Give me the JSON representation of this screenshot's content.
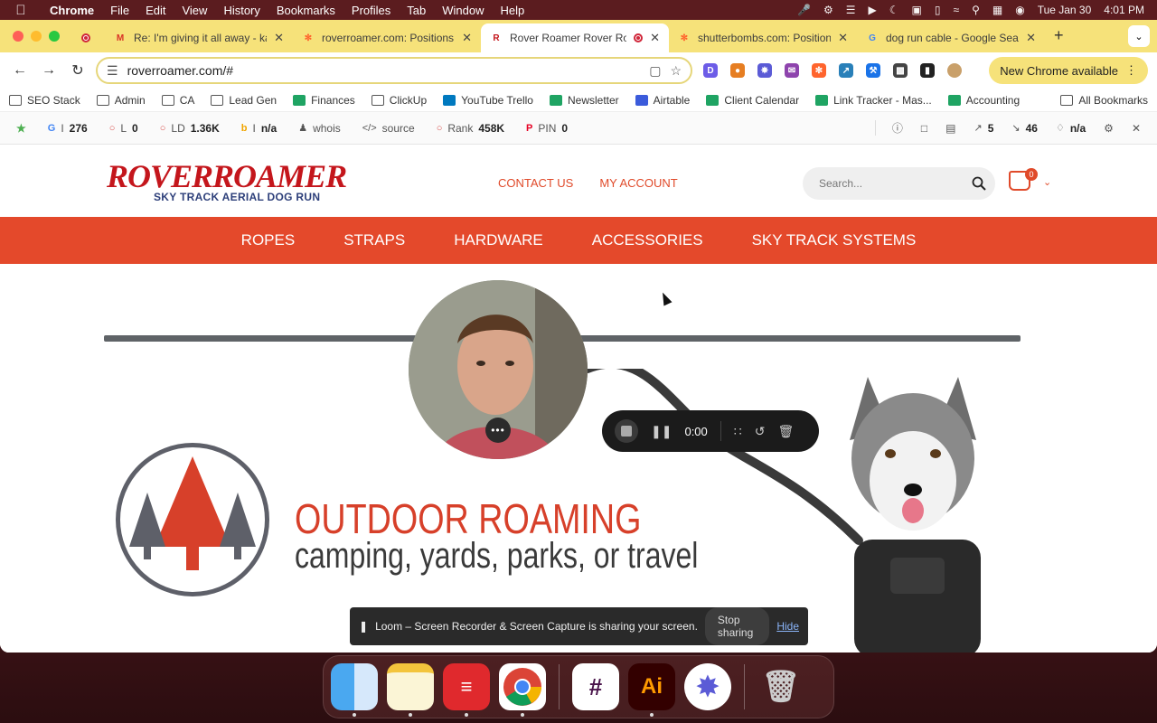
{
  "menubar": {
    "app": "Chrome",
    "items": [
      "File",
      "Edit",
      "View",
      "History",
      "Bookmarks",
      "Profiles",
      "Tab",
      "Window",
      "Help"
    ],
    "date": "Tue Jan 30",
    "time": "4:01 PM"
  },
  "tabs": [
    {
      "title": "Re: I'm giving it all away - kai",
      "icon": "gmail-icon",
      "active": false
    },
    {
      "title": "roverroamer.com: Positions, C",
      "icon": "semrush-icon",
      "active": false
    },
    {
      "title": "Rover Roamer Rover Roam",
      "icon": "roverroamer-icon",
      "active": true
    },
    {
      "title": "shutterbombs.com: Positions",
      "icon": "semrush-icon",
      "active": false
    },
    {
      "title": "dog run cable - Google Searc",
      "icon": "google-icon",
      "active": false
    }
  ],
  "toolbar": {
    "url": "roverroamer.com/#",
    "new_chrome": "New Chrome available"
  },
  "bookmarks": {
    "items": [
      {
        "label": "SEO Stack",
        "kind": "folder"
      },
      {
        "label": "Admin",
        "kind": "folder"
      },
      {
        "label": "CA",
        "kind": "folder"
      },
      {
        "label": "Lead Gen",
        "kind": "folder"
      },
      {
        "label": "Finances",
        "kind": "sheet"
      },
      {
        "label": "ClickUp",
        "kind": "folder"
      },
      {
        "label": "YouTube Trello",
        "kind": "trello"
      },
      {
        "label": "Newsletter",
        "kind": "sheet"
      },
      {
        "label": "Airtable",
        "kind": "airtable"
      },
      {
        "label": "Client Calendar",
        "kind": "sheet"
      },
      {
        "label": "Link Tracker - Mas...",
        "kind": "sheet"
      },
      {
        "label": "Accounting",
        "kind": "sheet"
      }
    ],
    "all_bookmarks": "All Bookmarks"
  },
  "seobar": {
    "items": [
      {
        "label": "I",
        "value": "276"
      },
      {
        "label": "L",
        "value": "0"
      },
      {
        "label": "LD",
        "value": "1.36K"
      },
      {
        "label": "I",
        "value": "n/a"
      },
      {
        "label": "whois",
        "value": ""
      },
      {
        "label": "source",
        "value": ""
      },
      {
        "label": "Rank",
        "value": "458K"
      },
      {
        "label": "PIN",
        "value": "0"
      }
    ],
    "right": {
      "ext_links": "5",
      "int_links": "46",
      "rating": "n/a"
    }
  },
  "site": {
    "logo_main": "ROVERROAMER",
    "logo_sub": "SKY TRACK AERIAL DOG RUN",
    "header_links": [
      "CONTACT US",
      "MY ACCOUNT"
    ],
    "search_placeholder": "Search...",
    "cart_count": "0",
    "nav": [
      "ROPES",
      "STRAPS",
      "HARDWARE",
      "ACCESSORIES",
      "SKY TRACK SYSTEMS"
    ],
    "hero_title": "OUTDOOR ROAMING",
    "hero_sub": "camping, yards, parks, or travel"
  },
  "loom": {
    "timer": "0:00",
    "share_message": "Loom – Screen Recorder & Screen Capture is sharing your screen.",
    "stop_sharing": "Stop sharing",
    "hide": "Hide"
  },
  "dock": [
    "finder",
    "notes",
    "elastic",
    "chrome",
    "slack",
    "illustrator",
    "perplexity",
    "trash"
  ],
  "colors": {
    "brand_red": "#e4492b",
    "tab_yellow": "#f6e27a",
    "logo_blue": "#2d3f7a"
  }
}
